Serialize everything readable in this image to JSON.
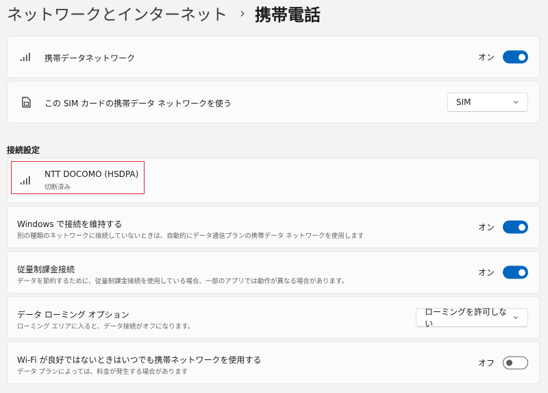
{
  "breadcrumb": {
    "parent": "ネットワークとインターネット",
    "separator": "›",
    "current": "携帯電話"
  },
  "cellular_data": {
    "title": "携帯データネットワーク",
    "icon": "signal-bars-icon",
    "toggle_label": "オン",
    "enabled": true
  },
  "sim": {
    "title": "この SIM カードの携帯データ ネットワークを使う",
    "icon": "sim-card-icon",
    "selected": "SIM"
  },
  "connection_settings": {
    "heading": "接続設定",
    "network": {
      "name": "NTT DOCOMO (HSDPA)",
      "status": "切断済み",
      "icon": "signal-bars-icon"
    }
  },
  "keep_connected": {
    "title": "Windows で接続を維持する",
    "description": "別の種類のネットワークに接続していないときは、自動的にデータ通信プランの携帯データ ネットワークを使用します",
    "toggle_label": "オン",
    "enabled": true
  },
  "metered": {
    "title": "従量制課金接続",
    "description": "データを節約するために、従量制課金接続を使用している場合、一部のアプリでは動作が異なる場合があります。",
    "toggle_label": "オン",
    "enabled": true
  },
  "roaming": {
    "title": "データ ローミング オプション",
    "description": "ローミング エリアに入ると、データ接続がオフになります。",
    "selected": "ローミングを許可しない"
  },
  "wifi_fallback": {
    "title": "Wi-Fi が良好ではないときはいつでも携帯ネットワークを使用する",
    "description": "データ プランによっては、料金が発生する場合があります",
    "toggle_label": "オフ",
    "enabled": false
  },
  "colors": {
    "accent": "#0067c0",
    "highlight": "#e0282e",
    "background": "#f3f3f3",
    "card": "#fbfbfb"
  }
}
